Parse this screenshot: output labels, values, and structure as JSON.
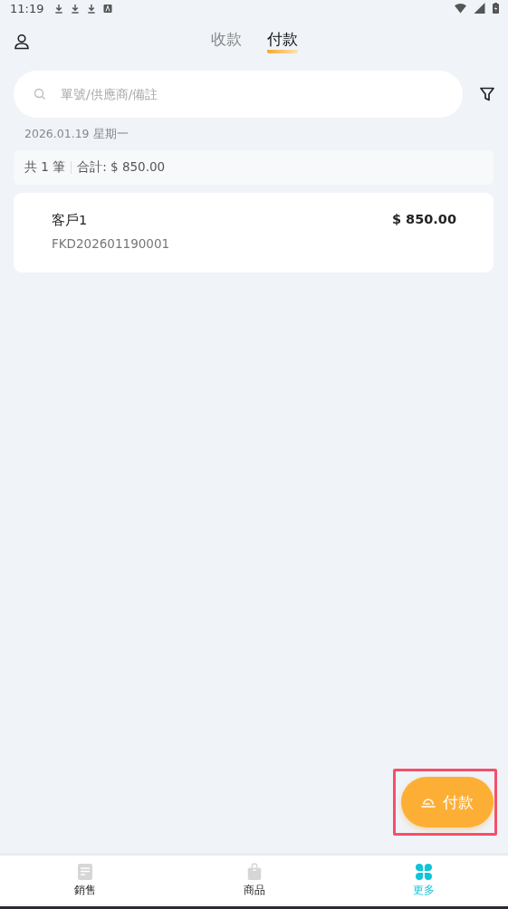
{
  "status_bar": {
    "time": "11:19"
  },
  "tabs": [
    {
      "label": "收款",
      "selected": false
    },
    {
      "label": "付款",
      "selected": true
    }
  ],
  "search": {
    "placeholder": "單號/供應商/備註"
  },
  "date": "2026.01.19 星期一",
  "summary": {
    "count": "共 1 筆",
    "total": "合計: $ 850.00"
  },
  "records": [
    {
      "name": "客戶1",
      "amount": "$ 850.00",
      "number": "FKD202601190001"
    }
  ],
  "fab": {
    "label": "付款",
    "highlighted": true
  },
  "nav": [
    {
      "label": "銷售",
      "kind": "doc",
      "selected": false
    },
    {
      "label": "商品",
      "kind": "bag",
      "selected": false
    },
    {
      "label": "更多",
      "kind": "clover",
      "selected": true
    }
  ]
}
